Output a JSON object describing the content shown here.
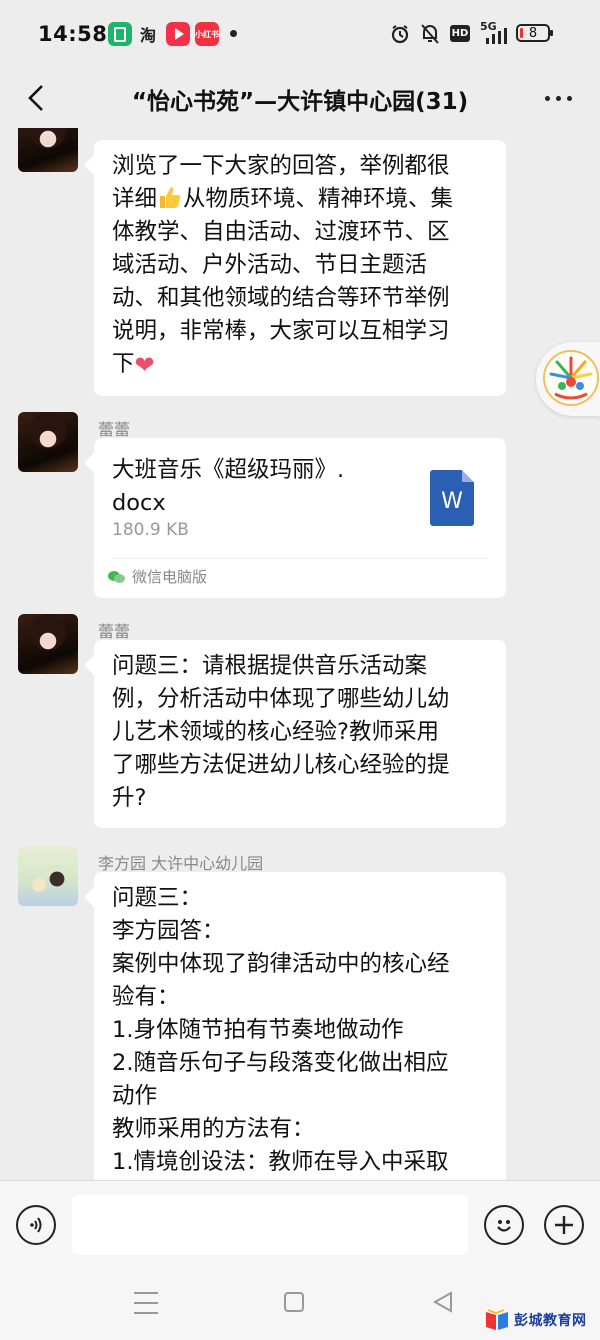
{
  "status_bar": {
    "time": "14:58",
    "apps": [
      {
        "icon": "green-square-icon",
        "color": "#1bb66c",
        "label": ""
      },
      {
        "icon": "taobao-icon",
        "color": "#ffffff",
        "label": "淘"
      },
      {
        "icon": "video-play-icon",
        "color": "#f4314b",
        "label": ""
      },
      {
        "icon": "xiaohongshu-icon",
        "color": "#f0313f",
        "label": "小红书"
      }
    ],
    "hd_label": "HD",
    "network_label": "5G",
    "battery_level": "8"
  },
  "header": {
    "title": "“怡心书苑”—大许镇中心园(31)"
  },
  "messages": [
    {
      "type": "text",
      "sender": "",
      "lines": [
        "浏览了一下大家的回答，举例都很",
        "详细",
        "从物质环境、精神环境、集",
        "体教学、自由活动、过渡环节、区",
        "域活动、户外活动、节日主题活",
        "动、和其他领域的结合等环节举例",
        "说明，非常棒，大家可以互相学习",
        "下"
      ]
    },
    {
      "type": "file",
      "sender": "蕾蕾",
      "file_name_line1": "大班音乐《超级玛丽》.",
      "file_name_line2": "docx",
      "file_size": "180.9 KB",
      "file_icon_letter": "W",
      "source": "微信电脑版"
    },
    {
      "type": "text",
      "sender": "蕾蕾",
      "lines": [
        "问题三：请根据提供音乐活动案",
        "例，分析活动中体现了哪些幼儿幼",
        "儿艺术领域的核心经验?教师采用",
        "了哪些方法促进幼儿核心经验的提",
        "升?"
      ]
    },
    {
      "type": "text",
      "sender": "李方园 大许中心幼儿园",
      "lines": [
        "问题三：",
        "李方园答：",
        "案例中体现了韵律活动中的核心经",
        "验有：",
        "1.身体随节拍有节奏地做动作",
        "2.随音乐句子与段落变化做出相应",
        "动作",
        "教师采用的方法有：",
        "1.情境创设法：教师在导入中采取"
      ]
    }
  ],
  "input_bar": {
    "placeholder": ""
  },
  "watermark": {
    "text": "彭城教育网"
  },
  "colors": {
    "background": "#ededed",
    "bubble": "#ffffff",
    "word_blue": "#2b5fb3",
    "wechat_green": "#3fb94d"
  }
}
